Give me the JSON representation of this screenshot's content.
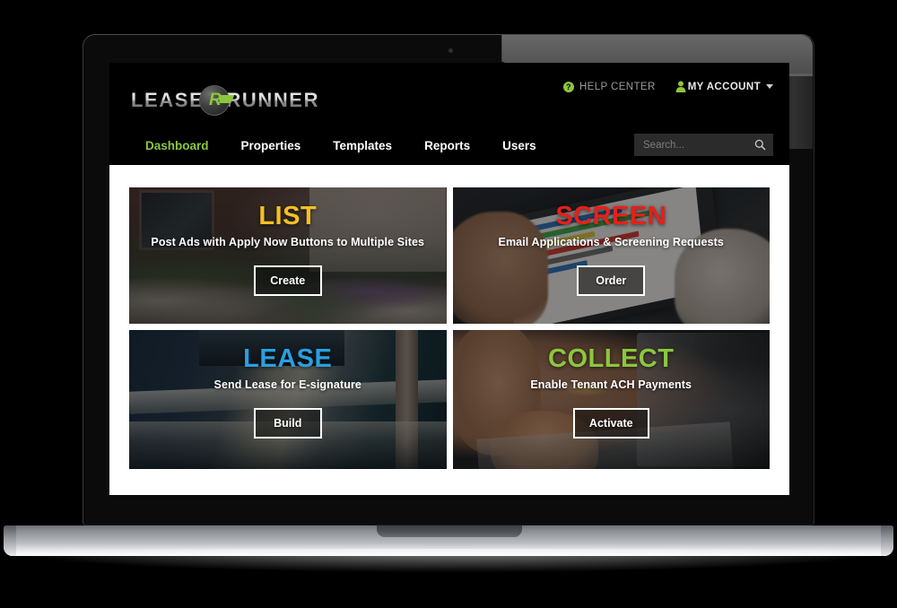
{
  "brand": {
    "logo_text_left": "LEASE",
    "logo_badge_text": "R",
    "logo_text_right": "RUNNER",
    "accent_green": "#8cc63e"
  },
  "header": {
    "help_center_label": "HELP CENTER",
    "help_center_icon": "question-circle-icon",
    "my_account_label": "MY ACCOUNT",
    "my_account_icon": "person-icon",
    "my_account_caret": "chevron-down-icon"
  },
  "nav": {
    "items": [
      {
        "label": "Dashboard",
        "active": true
      },
      {
        "label": "Properties",
        "active": false
      },
      {
        "label": "Templates",
        "active": false
      },
      {
        "label": "Reports",
        "active": false
      },
      {
        "label": "Users",
        "active": false
      }
    ]
  },
  "search": {
    "placeholder": "Search...",
    "value": "",
    "icon": "search-icon"
  },
  "dashboard": {
    "cards": [
      {
        "title": "LIST",
        "title_color": "#f5c024",
        "subtitle": "Post Ads with Apply Now Buttons to Multiple Sites",
        "button_label": "Create",
        "art": "brick-house-rock-garden-photo"
      },
      {
        "title": "SCREEN",
        "title_color": "#e81f19",
        "subtitle": "Email Applications & Screening Requests",
        "button_label": "Order",
        "art": "hands-holding-tablet-photo"
      },
      {
        "title": "LEASE",
        "title_color": "#2a9fe0",
        "subtitle": "Send Lease for E-signature",
        "button_label": "Build",
        "art": "interior-hallway-photo"
      },
      {
        "title": "COLLECT",
        "title_color": "#8cc63e",
        "subtitle": "Enable Tenant ACH Payments",
        "button_label": "Activate",
        "art": "hands-typing-laptop-photo"
      }
    ]
  },
  "device": {
    "type": "laptop-mockup",
    "webcam": "webcam-dot"
  }
}
